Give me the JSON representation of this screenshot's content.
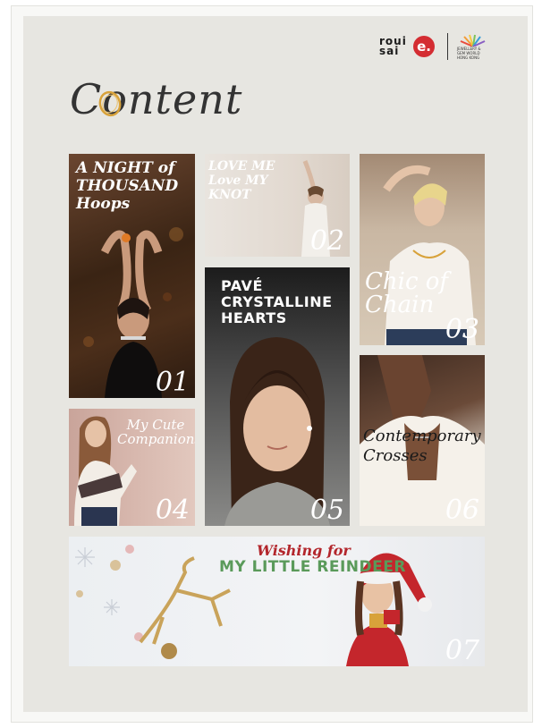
{
  "brand": {
    "logo_text": "roui sai",
    "badge_letter": "e.",
    "partner_text": "JEWELLERY & GEM WORLD HONG KONG"
  },
  "page_title": "Content",
  "tiles": [
    {
      "caption": "A NIGHT of THOUSAND Hoops",
      "number": "01"
    },
    {
      "caption": "LOVE ME Love MY KNOT",
      "number": "02"
    },
    {
      "caption": "Chic of Chain",
      "number": "03"
    },
    {
      "caption": "My Cute Companions",
      "number": "04"
    },
    {
      "caption": "PAVÉ CRYSTALLINE HEARTS",
      "number": "05"
    },
    {
      "caption": "Contemporary Crosses",
      "number": "06"
    },
    {
      "caption_script": "Wishing for",
      "caption": "MY LITTLE REINDEER",
      "number": "07"
    }
  ],
  "colors": {
    "page_bg": "#e7e6e1",
    "title_text": "#333333",
    "accent_gold": "#d8a23a",
    "brand_red": "#d42d32",
    "christmas_green": "#5a9a5a",
    "christmas_red": "#b3262c"
  }
}
